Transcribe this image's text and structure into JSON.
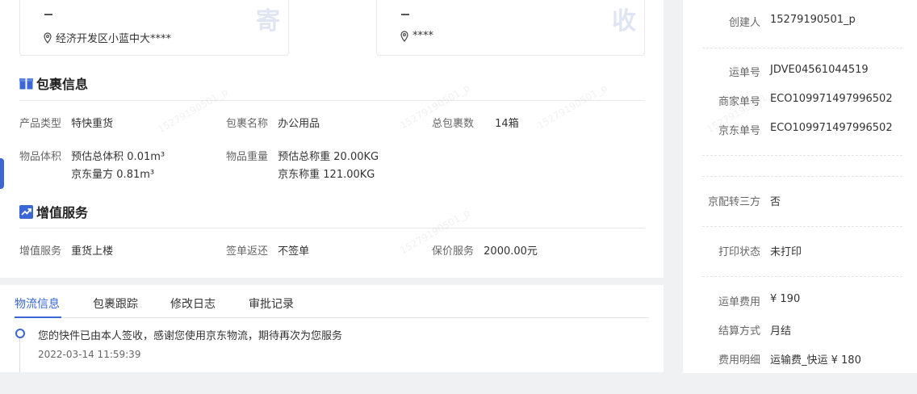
{
  "sender": {
    "corner": "寄",
    "address": "经济开发区小蓝中大****"
  },
  "receiver": {
    "corner": "收",
    "address": "****"
  },
  "package_section": {
    "title": "包裹信息",
    "product_type_label": "产品类型",
    "product_type": "特快重货",
    "package_name_label": "包裹名称",
    "package_name": "办公用品",
    "total_count_label": "总包裹数",
    "total_count": "14箱",
    "volume_label": "物品体积",
    "volume_est": "预估总体积 0.01m³",
    "volume_jd": "京东量方 0.81m³",
    "weight_label": "物品重量",
    "weight_est": "预估总称重 20.00KG",
    "weight_jd": "京东称重 121.00KG"
  },
  "value_section": {
    "title": "增值服务",
    "service_label": "增值服务",
    "service": "重货上楼",
    "sign_return_label": "签单返还",
    "sign_return": "不签单",
    "insure_label": "保价服务",
    "insure": "2000.00元"
  },
  "tabs": {
    "logistics": "物流信息",
    "tracking": "包裹跟踪",
    "changelog": "修改日志",
    "approval": "审批记录"
  },
  "timeline": {
    "text": "您的快件已由本人签收，感谢您使用京东物流，期待再次为您服务",
    "time": "2022-03-14 11:59:39"
  },
  "side": {
    "creator_label": "创建人",
    "creator": "15279190501_p",
    "waybill_label": "运单号",
    "waybill": "JDVE04561044519",
    "merchant_label": "商家单号",
    "merchant": "ECO109971497996502",
    "jd_label": "京东单号",
    "jd": "ECO109971497996502",
    "third_label": "京配转三方",
    "third": "否",
    "print_label": "打印状态",
    "print": "未打印",
    "fee_label": "运单费用",
    "fee": "¥ 190",
    "settle_label": "结算方式",
    "settle": "月结",
    "detail_label": "费用明细",
    "detail": "运输费_快运 ¥ 180"
  },
  "watermark": "15279190501_p"
}
